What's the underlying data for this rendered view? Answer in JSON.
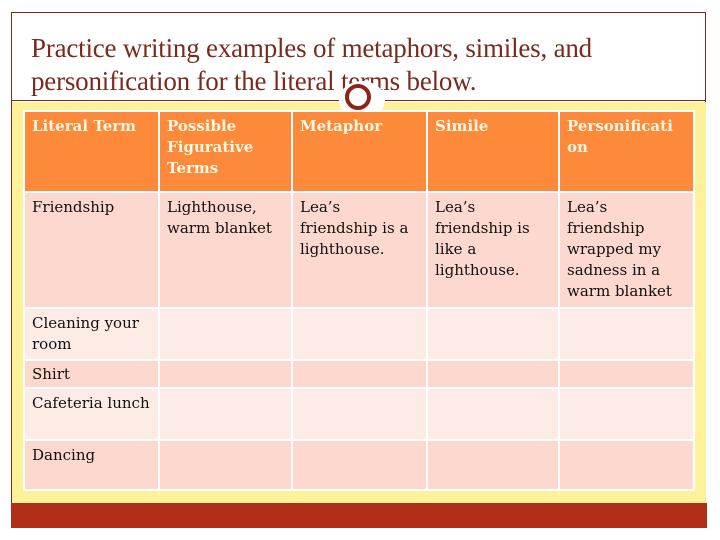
{
  "slide": {
    "title": "Practice writing examples of metaphors, similes, and personification for the literal terms below.",
    "colors": {
      "title_text": "#7b2a1c",
      "header_fill": "#fd8a3a",
      "row_dark": "#fdd8cf",
      "row_light": "#fdece6",
      "band": "#fdf19a",
      "bottom_bar": "#b22e18"
    }
  },
  "table": {
    "headers": [
      "Literal Term",
      "Possible Figurative Terms",
      "Metaphor",
      "Simile",
      "Personificati on"
    ],
    "rows": [
      [
        "Friendship",
        "Lighthouse, warm blanket",
        "Lea’s friendship is a lighthouse.",
        "Lea’s friendship is like a lighthouse.",
        "Lea’s friendship wrapped my sadness in a warm blanket"
      ],
      [
        "Cleaning your room",
        "",
        "",
        "",
        ""
      ],
      [
        "Shirt",
        "",
        "",
        "",
        ""
      ],
      [
        "Cafeteria lunch",
        "",
        "",
        "",
        ""
      ],
      [
        "Dancing",
        "",
        "",
        "",
        ""
      ]
    ]
  }
}
